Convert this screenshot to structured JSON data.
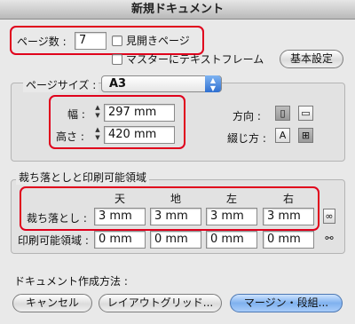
{
  "window": {
    "title": "新規ドキュメント"
  },
  "top": {
    "pages_label": "ページ数 :",
    "pages_value": "7",
    "facing_pages_label": "見開きページ",
    "master_text_frame_label": "マスターにテキストフレーム",
    "basic_settings_button": "基本設定"
  },
  "page_size": {
    "label": "ページサイズ :",
    "selected": "A3",
    "width_label": "幅 :",
    "width_value": "297 mm",
    "height_label": "高さ :",
    "height_value": "420 mm",
    "orientation_label": "方向 :",
    "binding_label": "綴じ方 :",
    "orientation_portrait_icon": "portrait-icon",
    "orientation_landscape_icon": "landscape-icon"
  },
  "bleed": {
    "group_title": "裁ち落としと印刷可能領域",
    "columns": [
      "天",
      "地",
      "左",
      "右"
    ],
    "bleed_label": "裁ち落とし :",
    "bleed_values": [
      "3 mm",
      "3 mm",
      "3 mm",
      "3 mm"
    ],
    "slug_label": "印刷可能領域 :",
    "slug_values": [
      "0 mm",
      "0 mm",
      "0 mm",
      "0 mm"
    ]
  },
  "create": {
    "label": "ドキュメント作成方法 :",
    "cancel_button": "キャンセル",
    "layout_grid_button": "レイアウトグリッド...",
    "margins_columns_button": "マージン・段組..."
  },
  "colors": {
    "highlight": "#e0001c",
    "primary_button": "#7fb1ef"
  }
}
